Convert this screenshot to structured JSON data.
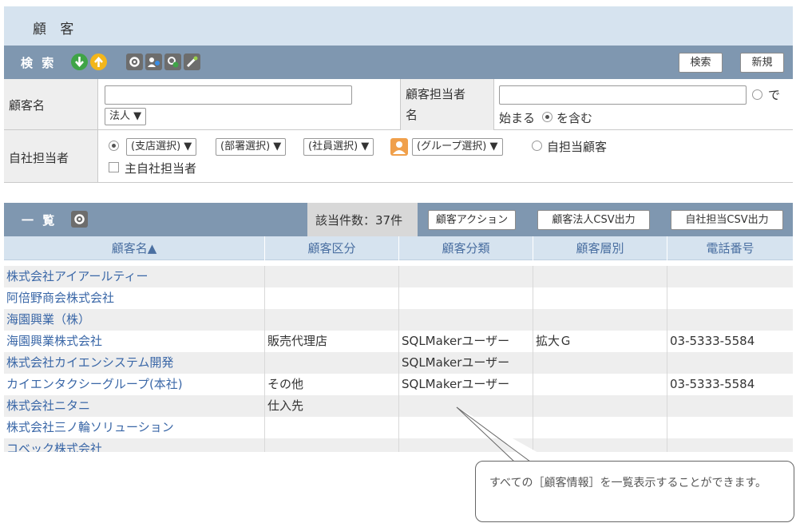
{
  "page": {
    "title": "顧 客"
  },
  "search": {
    "label": "検 索",
    "search_button": "検索",
    "new_button": "新規",
    "icons": [
      "arrow-down-green-icon",
      "arrow-up-yellow-icon",
      "gear-icon",
      "person-settings-icon",
      "cog-refresh-icon",
      "tools-icon"
    ]
  },
  "form": {
    "customer_name_label": "顧客名",
    "corp_select": "法人 ▼",
    "customer_rep_label_1": "顧客担当者",
    "customer_rep_label_2": "名",
    "match_de": "で",
    "match_starts": "始まる",
    "match_contains": "を含む",
    "company_rep_label": "自社担当者",
    "branch_select": "(支店選択) ▼",
    "dept_select": "(部署選択) ▼",
    "employee_select": "(社員選択) ▼",
    "group_select": "(グループ選択) ▼",
    "self_customer": "自担当顧客",
    "main_rep": "主自社担当者"
  },
  "list": {
    "label": "一 覧",
    "count_text": "該当件数：37件",
    "action_button": "顧客アクション",
    "csv_corp_button": "顧客法人CSV出力",
    "csv_rep_button": "自社担当CSV出力",
    "columns": [
      "顧客名▲",
      "顧客区分",
      "顧客分類",
      "顧客層別",
      "電話番号"
    ],
    "rows": [
      [
        "株式会社アイアールティー",
        "",
        "",
        "",
        ""
      ],
      [
        "阿倍野商会株式会社",
        "",
        "",
        "",
        ""
      ],
      [
        "海園興業（株）",
        "",
        "",
        "",
        ""
      ],
      [
        "海園興業株式会社",
        "販売代理店",
        "SQLMakerユーザー",
        "拡大Ｇ",
        "03-5333-5584"
      ],
      [
        "株式会社カイエンシステム開発",
        "",
        "SQLMakerユーザー",
        "",
        ""
      ],
      [
        "カイエンタクシーグループ(本社)",
        "その他",
        "SQLMakerユーザー",
        "",
        "03-5333-5584"
      ],
      [
        "株式会社ニタニ",
        "仕入先",
        "",
        "",
        ""
      ],
      [
        "株式会社三ノ輪ソリューション",
        "",
        "",
        "",
        ""
      ],
      [
        "コベック株式会社",
        "",
        "",
        "",
        ""
      ]
    ]
  },
  "callout": {
    "text": "すべての［顧客情報］を一覧表示することができます。"
  },
  "colors": {
    "header_bar": "#7f97b0",
    "title_bg": "#d6e3ef",
    "link": "#3a67a7"
  }
}
